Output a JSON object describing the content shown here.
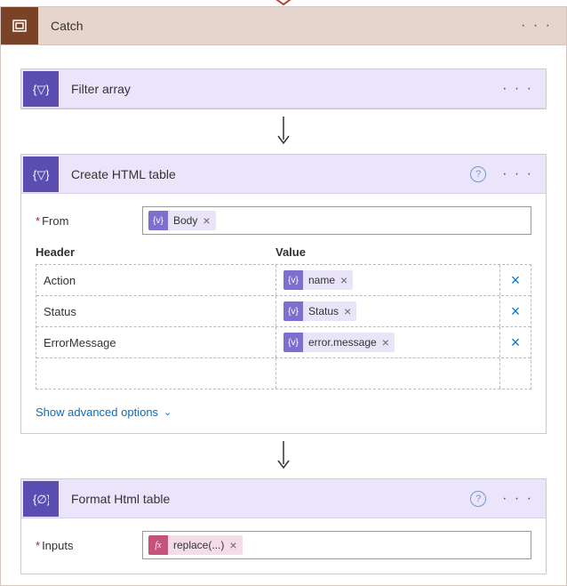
{
  "scope": {
    "title": "Catch"
  },
  "actions": {
    "filter": {
      "title": "Filter array"
    },
    "createTable": {
      "title": "Create HTML table",
      "fromLabel": "From",
      "fromToken": "Body",
      "colHeaderLabel": "Header",
      "colValueLabel": "Value",
      "rows": [
        {
          "header": "Action",
          "token": "name"
        },
        {
          "header": "Status",
          "token": "Status"
        },
        {
          "header": "ErrorMessage",
          "token": "error.message"
        }
      ],
      "advancedLink": "Show advanced options"
    },
    "format": {
      "title": "Format Html table",
      "inputsLabel": "Inputs",
      "inputsToken": "replace(...)"
    }
  },
  "glyphs": {
    "close": "×",
    "help": "?",
    "chevDown": "⌄"
  }
}
